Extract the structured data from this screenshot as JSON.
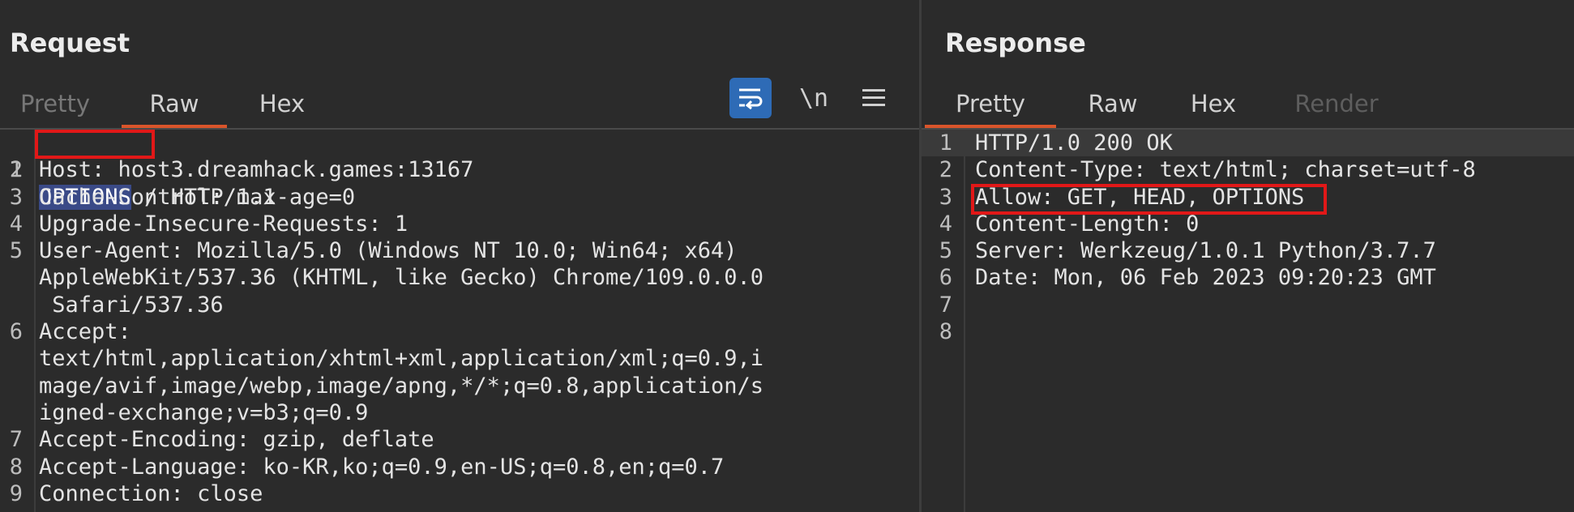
{
  "request": {
    "title": "Request",
    "tabs": [
      "Pretty",
      "Raw",
      "Hex"
    ],
    "active_tab": "Raw",
    "toolbar": {
      "wrap_icon": "wrap-lines-icon",
      "newline_label": "\\n",
      "menu_icon": "hamburger-menu-icon"
    },
    "lines": [
      {
        "n": "1",
        "text": " / HTTP/1.1",
        "method": "OPTIONS"
      },
      {
        "n": "2",
        "text": "Host: host3.dreamhack.games:13167"
      },
      {
        "n": "3",
        "text": "Cache-Control: max-age=0"
      },
      {
        "n": "4",
        "text": "Upgrade-Insecure-Requests: 1"
      },
      {
        "n": "5",
        "text": "User-Agent: Mozilla/5.0 (Windows NT 10.0; Win64; x64)"
      },
      {
        "n": "",
        "text": "AppleWebKit/537.36 (KHTML, like Gecko) Chrome/109.0.0.0"
      },
      {
        "n": "",
        "text": " Safari/537.36"
      },
      {
        "n": "6",
        "text": "Accept:"
      },
      {
        "n": "",
        "text": "text/html,application/xhtml+xml,application/xml;q=0.9,i"
      },
      {
        "n": "",
        "text": "mage/avif,image/webp,image/apng,*/*;q=0.8,application/s"
      },
      {
        "n": "",
        "text": "igned-exchange;v=b3;q=0.9"
      },
      {
        "n": "7",
        "text": "Accept-Encoding: gzip, deflate"
      },
      {
        "n": "8",
        "text": "Accept-Language: ko-KR,ko;q=0.9,en-US;q=0.8,en;q=0.7"
      },
      {
        "n": "9",
        "text": "Connection: close"
      }
    ]
  },
  "response": {
    "title": "Response",
    "tabs": [
      "Pretty",
      "Raw",
      "Hex",
      "Render"
    ],
    "active_tab": "Pretty",
    "lines": [
      {
        "n": "1",
        "text": "HTTP/1.0 200 OK"
      },
      {
        "n": "2",
        "text": "Content-Type: text/html; charset=utf-8"
      },
      {
        "n": "3",
        "text": "Allow: GET, HEAD, OPTIONS"
      },
      {
        "n": "4",
        "text": "Content-Length: 0"
      },
      {
        "n": "5",
        "text": "Server: Werkzeug/1.0.1 Python/3.7.7"
      },
      {
        "n": "6",
        "text": "Date: Mon, 06 Feb 2023 09:20:23 GMT"
      },
      {
        "n": "7",
        "text": ""
      },
      {
        "n": "8",
        "text": ""
      }
    ]
  },
  "colors": {
    "accent": "#d9552b",
    "highlight_box": "#e11818",
    "selection": "#3a4a87",
    "wrap_button": "#2e6bb6"
  }
}
